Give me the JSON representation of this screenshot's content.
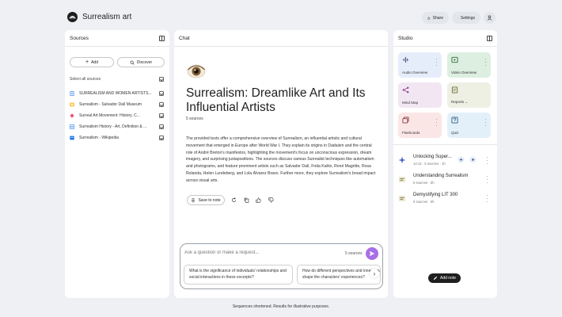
{
  "app": {
    "title": "Surrealism art"
  },
  "topbar": {
    "share_label": "Share",
    "settings_label": "Settings"
  },
  "sources": {
    "header": "Sources",
    "add_label": "Add",
    "discover_label": "Discover",
    "select_all_label": "Select all sources",
    "items": [
      {
        "label": "SURREALISM AND WOMEN ARTISTS...",
        "icon": "pdf-icon",
        "color": "#1a73e8"
      },
      {
        "label": "Surrealism - Salvador Dalí Museum",
        "icon": "web-icon",
        "color": "#f9c23c"
      },
      {
        "label": "Surreal Art Movement: History, C...",
        "icon": "web-icon",
        "color": "#e8557c"
      },
      {
        "label": "Surrealism History - Art, Definition & ...",
        "icon": "web-icon",
        "color": "#1a73e8"
      },
      {
        "label": "Surrealism - Wikipedia",
        "icon": "web-icon",
        "color": "#1a73e8"
      }
    ]
  },
  "chat": {
    "header": "Chat",
    "title": "Surrealism: Dreamlike Art and Its Influential Artists",
    "source_count": "5 sources",
    "body": "The provided texts offer a comprehensive overview of Surrealism, an influential artistic and cultural movement that emerged in Europe after World War I. They explain its origins in Dadaism and the central role of André Breton's manifestos, highlighting the movement's focus on unconscious expression, dream imagery, and surprising juxtapositions. The sources discuss various Surrealist techniques like automatism and photograms, and feature prominent artists such as Salvador Dalí, Frida Kahlo, René Magritte, Rosa Rolanda, Helen Lundeberg, and Lola Álvarez Bravo. Further more, they explore Surrealism's broad impact across visual arts.",
    "save_note_label": "Save to note",
    "composer": {
      "placeholder": "Ask a question or make a request...",
      "sources_label": "5 sources"
    },
    "suggestions": [
      "What is the significance of individuals' relationships and social interactions in these excerpts?",
      "How do different perspectives and inner thoughts shape the characters' experiences?"
    ]
  },
  "studio": {
    "header": "Studio",
    "tiles": [
      {
        "label": "Audio Overview",
        "bg": "#e6edfa",
        "icon": "waveform-icon"
      },
      {
        "label": "Video Overview",
        "bg": "#dcefe0",
        "icon": "video-icon"
      },
      {
        "label": "Mind Map",
        "bg": "#f3e6f3",
        "icon": "mindmap-icon"
      },
      {
        "label": "Reports",
        "bg": "#eef0e4",
        "icon": "reports-icon"
      },
      {
        "label": "Flashcards",
        "bg": "#fbe6e6",
        "icon": "flashcards-icon"
      },
      {
        "label": "Quiz",
        "bg": "#e3f0fa",
        "icon": "quiz-icon"
      }
    ],
    "notes": [
      {
        "title": "Unlocking Super...",
        "meta": "14:13 · 5 sources · 1h"
      },
      {
        "title": "Understanding Surrealism",
        "meta": "5 sources · 5h"
      },
      {
        "title": "Demystifying LIT 300",
        "meta": "5 sources · 5h"
      }
    ],
    "add_note_label": "Add note"
  },
  "footer": {
    "text": "Sequences shortened. Results for illustrative purposes."
  }
}
